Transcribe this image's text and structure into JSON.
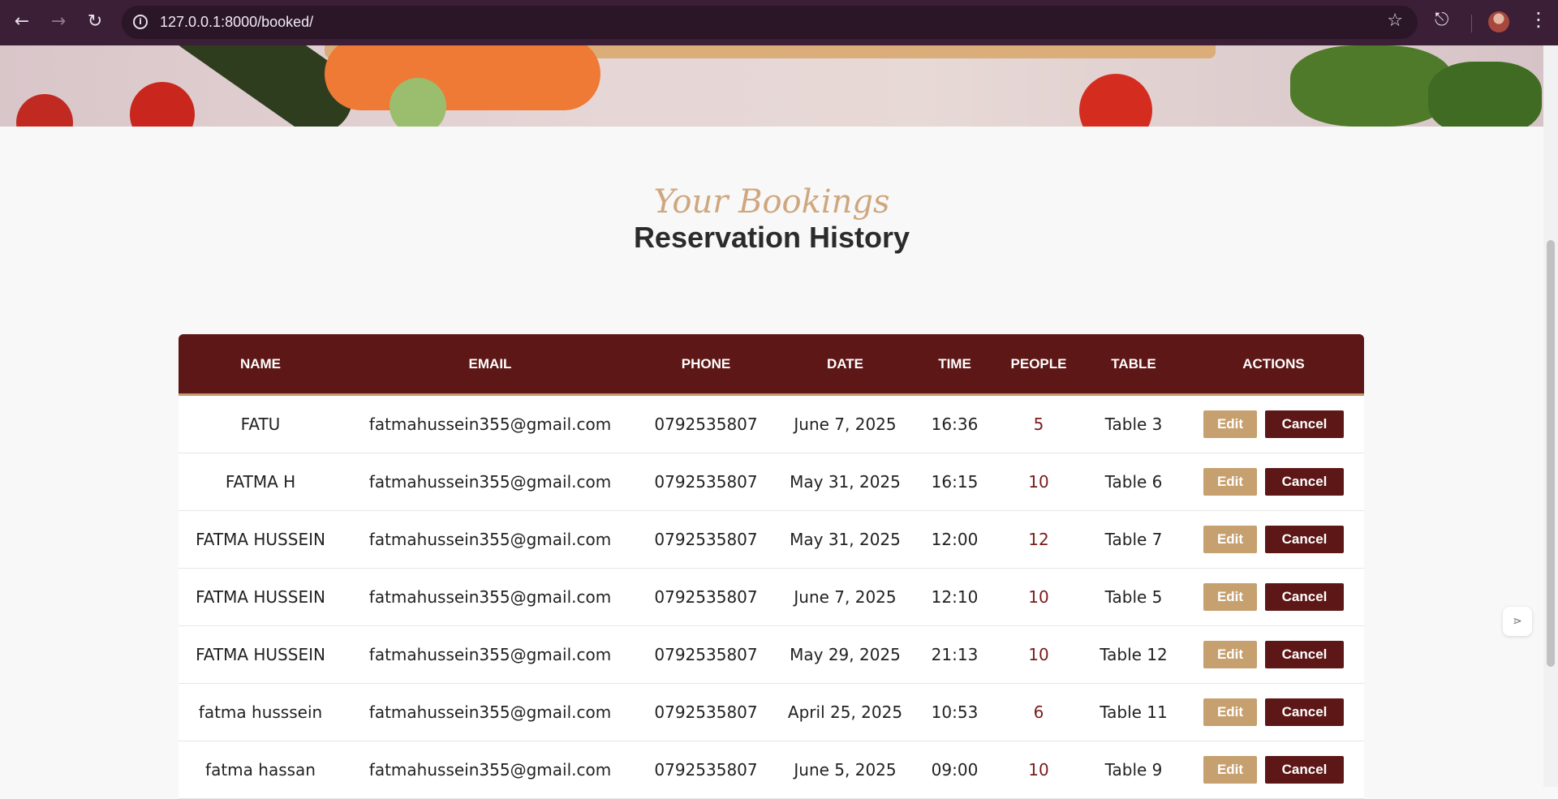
{
  "browser": {
    "url": "127.0.0.1:8000/booked/"
  },
  "heading": {
    "eyebrow": "Your Bookings",
    "title": "Reservation History"
  },
  "table": {
    "headers": [
      "NAME",
      "EMAIL",
      "PHONE",
      "DATE",
      "TIME",
      "PEOPLE",
      "TABLE",
      "ACTIONS"
    ],
    "rows": [
      {
        "name": "FATU",
        "email": "fatmahussein355@gmail.com",
        "phone": "0792535807",
        "date": "June 7, 2025",
        "time": "16:36",
        "people": "5",
        "table": "Table 3"
      },
      {
        "name": "FATMA H",
        "email": "fatmahussein355@gmail.com",
        "phone": "0792535807",
        "date": "May 31, 2025",
        "time": "16:15",
        "people": "10",
        "table": "Table 6"
      },
      {
        "name": "FATMA HUSSEIN",
        "email": "fatmahussein355@gmail.com",
        "phone": "0792535807",
        "date": "May 31, 2025",
        "time": "12:00",
        "people": "12",
        "table": "Table 7"
      },
      {
        "name": "FATMA HUSSEIN",
        "email": "fatmahussein355@gmail.com",
        "phone": "0792535807",
        "date": "June 7, 2025",
        "time": "12:10",
        "people": "10",
        "table": "Table 5"
      },
      {
        "name": "FATMA HUSSEIN",
        "email": "fatmahussein355@gmail.com",
        "phone": "0792535807",
        "date": "May 29, 2025",
        "time": "21:13",
        "people": "10",
        "table": "Table 12"
      },
      {
        "name": "fatma husssein",
        "email": "fatmahussein355@gmail.com",
        "phone": "0792535807",
        "date": "April 25, 2025",
        "time": "10:53",
        "people": "6",
        "table": "Table 11"
      },
      {
        "name": "fatma hassan",
        "email": "fatmahussein355@gmail.com",
        "phone": "0792535807",
        "date": "June 5, 2025",
        "time": "09:00",
        "people": "10",
        "table": "Table 9"
      }
    ],
    "edit_label": "Edit",
    "cancel_label": "Cancel"
  },
  "colors": {
    "header_bg": "#5d1716",
    "accent": "#c6a06f",
    "chrome_bg": "#3a1f36"
  },
  "icons": [
    "back-arrow-icon",
    "forward-arrow-icon",
    "reload-icon",
    "info-icon",
    "bookmark-star-icon",
    "extensions-icon",
    "profile-avatar-icon",
    "more-menu-icon"
  ]
}
